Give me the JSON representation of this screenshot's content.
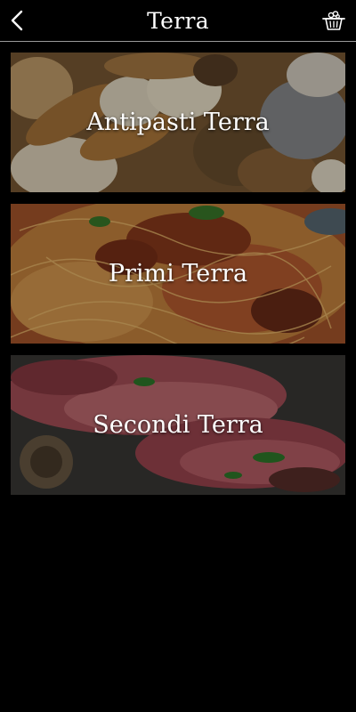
{
  "header": {
    "title": "Terra",
    "back_icon": "chevron-left-icon",
    "cart_icon": "shopping-basket-icon"
  },
  "categories": [
    {
      "label": "Antipasti Terra",
      "image": "fried-appetizers"
    },
    {
      "label": "Primi Terra",
      "image": "spaghetti-bolognese"
    },
    {
      "label": "Secondi Terra",
      "image": "sliced-steak"
    }
  ],
  "colors": {
    "background": "#000000",
    "divider": "#9a9a9a",
    "text": "#ffffff"
  }
}
